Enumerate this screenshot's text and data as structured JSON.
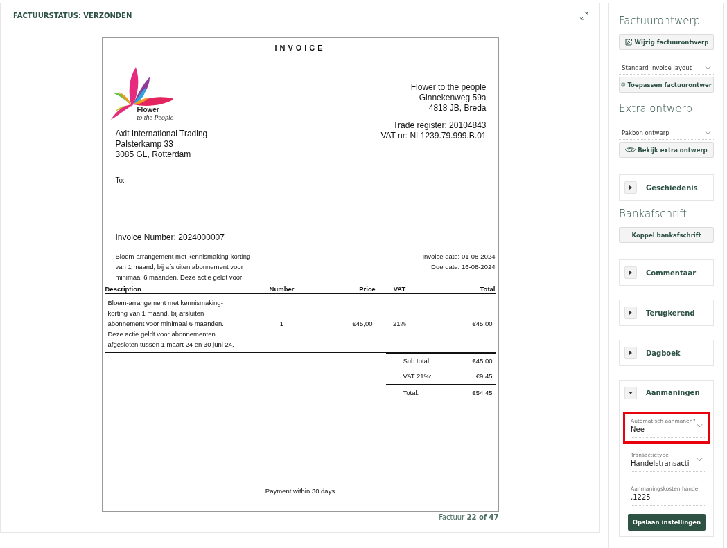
{
  "panel": {
    "title": "FACTUURSTATUS: VERZONDEN"
  },
  "invoice": {
    "heading": "INVOICE",
    "logo": {
      "line_1": "Flower",
      "line_2": "to the People"
    },
    "sender": [
      "Flower to the people",
      "Ginnekenweg 59a",
      "4818 JB, Breda"
    ],
    "registration": [
      "Trade register: 20104843",
      "VAT nr: NL1239.79.999.B.01"
    ],
    "customer": [
      "Axit International Trading",
      "Palsterkamp 33",
      "3085 GL, Rotterdam"
    ],
    "to_label": "To:",
    "number": "Invoice Number: 2024000007",
    "note": "Bloem-arrangement met kennismaking-korting van 1 maand, bij afsluiten abonnement voor minimaal 6 maanden. Deze actie geldt voor",
    "dates": [
      "Invoice date: 01-08-2024",
      "Due date: 16-08-2024"
    ],
    "columns": [
      "Description",
      "Number",
      "Price",
      "VAT",
      "Total"
    ],
    "rows": [
      {
        "description": "Bloem-arrangement met kennismaking-korting van 1 maand, bij afsluiten abonnement voor minimaal 6 maanden. Deze actie geldt voor abonnementen afgesloten tussen 1 maart 24 en 30 juni 24,",
        "number": "1",
        "price": "€45,00",
        "vat": "21%",
        "total": "€45,00"
      }
    ],
    "totals": [
      {
        "label": "Sub total:",
        "value": "€45,00"
      },
      {
        "label": "VAT 21%:",
        "value": "€9,45"
      },
      {
        "label": "Total:",
        "value": "€54,45"
      }
    ],
    "footer": "Payment within 30 days"
  },
  "pager": {
    "label": "Factuur",
    "position": "22 of 47"
  },
  "sidebar": [
    {
      "kind": "heading",
      "text": "Factuurontwerp"
    },
    {
      "kind": "button",
      "label": "Wijzig factuurontwerp"
    },
    {
      "kind": "select",
      "value": "Standard Invoice layout"
    },
    {
      "kind": "button",
      "label": "Toepassen factuurontwer"
    },
    {
      "kind": "heading",
      "text": "Extra ontwerp"
    },
    {
      "kind": "select",
      "value": "Pakbon ontwerp"
    },
    {
      "kind": "button",
      "label": "Bekijk extra ontwerp"
    },
    {
      "kind": "accordion",
      "title": "Geschiedenis",
      "expanded": false
    },
    {
      "kind": "heading",
      "text": "Bankafschrift"
    },
    {
      "kind": "button",
      "label": "Koppel bankafschrift"
    },
    {
      "kind": "accordion",
      "title": "Commentaar",
      "expanded": false
    },
    {
      "kind": "accordion",
      "title": "Terugkerend",
      "expanded": false
    },
    {
      "kind": "accordion",
      "title": "Dagboek",
      "expanded": false
    },
    {
      "kind": "accordion",
      "title": "Aanmaningen",
      "expanded": true,
      "fields": [
        {
          "kind": "select",
          "label": "Automatisch aanmanen?",
          "value": "Nee",
          "highlighted": true
        },
        {
          "kind": "select",
          "label": "Transactietype",
          "value": "Handelstransacti",
          "highlighted": false
        },
        {
          "kind": "input",
          "label": "Aanmaningskosten hande",
          "value": ",1225",
          "highlighted": false
        }
      ],
      "action": "Opslaan instellingen"
    }
  ]
}
